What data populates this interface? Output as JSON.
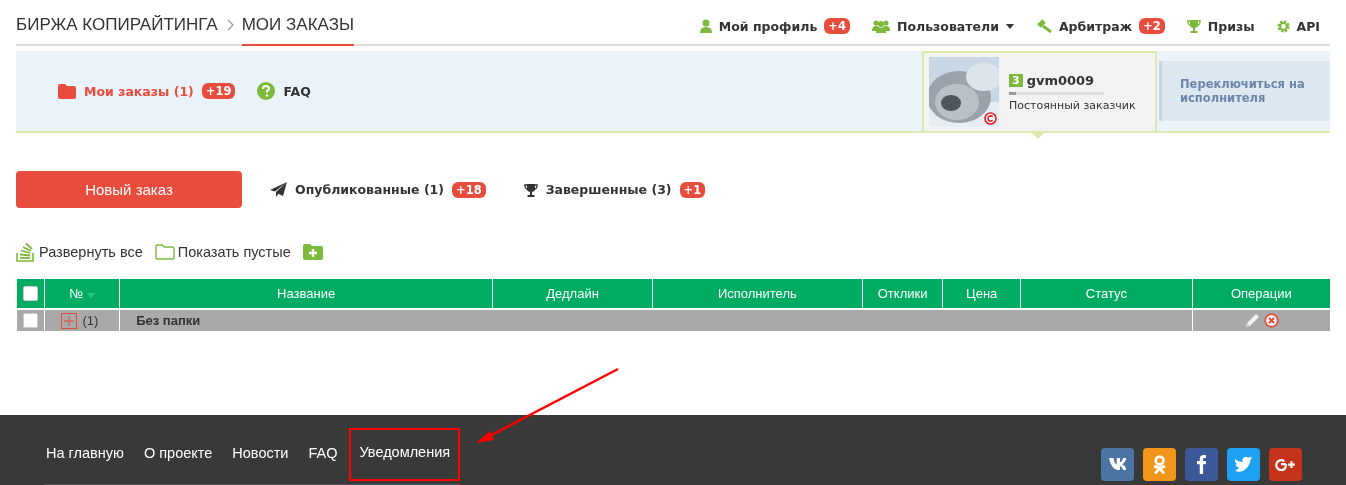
{
  "header": {
    "breadcrumb": [
      {
        "label": "БИРЖА КОПИРАЙТИНГА",
        "selected": false
      },
      {
        "label": "МОИ ЗАКАЗЫ",
        "selected": true
      }
    ],
    "nav": [
      {
        "kind": "user",
        "label": "Мой профиль",
        "badge": "+4"
      },
      {
        "kind": "users",
        "label": "Пользователи",
        "dropdown": true
      },
      {
        "kind": "gavel",
        "label": "Арбитраж",
        "badge": "+2"
      },
      {
        "kind": "trophy",
        "label": "Призы"
      },
      {
        "kind": "gear",
        "label": "API"
      }
    ]
  },
  "subnav": {
    "items": [
      {
        "kind": "folder",
        "label": "Мои заказы (1)",
        "badge": "+19",
        "selected": true
      },
      {
        "kind": "help",
        "label": "FAQ",
        "selected": false
      }
    ]
  },
  "profile": {
    "rank": "3",
    "username": "gvm0009",
    "level": 0.07,
    "role": "Постоянный заказчик",
    "switch_label": "Переключиться на исполнителя"
  },
  "actions": {
    "new_order": "Новый заказ",
    "tabs": [
      {
        "kind": "plane",
        "label": "Опубликованные (1)",
        "badge": "+18"
      },
      {
        "kind": "trophy",
        "label": "Завершенные (3)",
        "badge": "+1"
      }
    ]
  },
  "toolbar": [
    {
      "kind": "expand",
      "label": "Развернуть все"
    },
    {
      "kind": "folder",
      "label": "Показать пустые"
    },
    {
      "kind": "add-folder"
    }
  ],
  "table": {
    "select_all": false,
    "columns": [
      "№",
      "Название",
      "Дедлайн",
      "Исполнитель",
      "Отклики",
      "Цена",
      "Статус",
      "Операции"
    ],
    "rows": [
      {
        "checked": false,
        "expanded": false,
        "count": "(1)",
        "name": "Без папки"
      }
    ]
  },
  "footer": {
    "links": [
      {
        "label": "На главную",
        "highlighted": false
      },
      {
        "label": "О проекте",
        "highlighted": false
      },
      {
        "label": "Новости",
        "highlighted": false
      },
      {
        "label": "FAQ",
        "highlighted": false
      },
      {
        "label": "Уведомления",
        "highlighted": true
      }
    ],
    "social": [
      {
        "kind": "vk"
      },
      {
        "kind": "ok"
      },
      {
        "kind": "facebook"
      },
      {
        "kind": "twitter"
      },
      {
        "kind": "gplus"
      }
    ]
  }
}
